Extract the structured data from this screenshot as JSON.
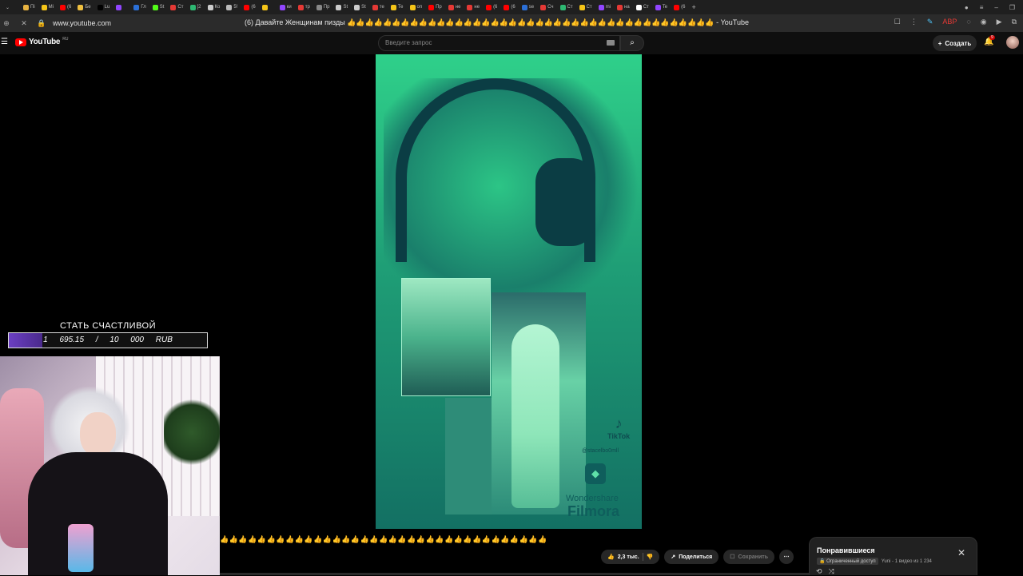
{
  "browser": {
    "tabs": [
      {
        "label": "Пі",
        "color": "#e8b341"
      },
      {
        "label": "Mi",
        "color": "#f5c518"
      },
      {
        "label": "(6",
        "color": "#ff0000"
      },
      {
        "label": "Бе",
        "color": "#f0c040"
      },
      {
        "label": "Lu",
        "color": "#000000"
      },
      {
        "label": "",
        "color": "#9146ff"
      },
      {
        "label": "Гл",
        "color": "#2b6fd6"
      },
      {
        "label": "St",
        "color": "#53fc18"
      },
      {
        "label": "Ст",
        "color": "#e53935"
      },
      {
        "label": "[2",
        "color": "#2eb872"
      },
      {
        "label": "Ко",
        "color": "#cccccc"
      },
      {
        "label": "5!",
        "color": "#bbbbbb"
      },
      {
        "label": "(6",
        "color": "#ff0000"
      },
      {
        "label": "",
        "color": "#f5c518"
      },
      {
        "label": "ки",
        "color": "#9146ff"
      },
      {
        "label": "тр",
        "color": "#e53935"
      },
      {
        "label": "Пр",
        "color": "#888888"
      },
      {
        "label": "St",
        "color": "#cccccc"
      },
      {
        "label": "St",
        "color": "#cccccc"
      },
      {
        "label": "те",
        "color": "#e53935"
      },
      {
        "label": "Те",
        "color": "#f5c518"
      },
      {
        "label": "оп",
        "color": "#f5c518"
      },
      {
        "label": "Пр",
        "color": "#ff0000"
      },
      {
        "label": "не",
        "color": "#e53935"
      },
      {
        "label": "не",
        "color": "#e53935"
      },
      {
        "label": "(6",
        "color": "#ff0000"
      },
      {
        "label": "(6",
        "color": "#ff0000"
      },
      {
        "label": "se",
        "color": "#2b6fd6"
      },
      {
        "label": "Сч",
        "color": "#e53935"
      },
      {
        "label": "Ст",
        "color": "#2eb872"
      },
      {
        "label": "Ст",
        "color": "#f5c518"
      },
      {
        "label": "mi",
        "color": "#9146ff"
      },
      {
        "label": "на",
        "color": "#e53935"
      },
      {
        "label": "Ст",
        "color": "#ffffff"
      },
      {
        "label": "Te",
        "color": "#9146ff"
      },
      {
        "label": "(6",
        "color": "#ff0000"
      }
    ],
    "url": "www.youtube.com",
    "page_title": "(6) Давайте Женщинам пизды 👍👍👍👍👍👍👍👍👍👍👍👍👍👍👍👍👍👍👍👍👍👍👍👍👍👍👍👍👍👍👍👍👍👍👍👍👍👍👍👍👍 - YouTube"
  },
  "youtube": {
    "logo_text": "YouTube",
    "logo_region": "RU",
    "search_placeholder": "Введите запрос",
    "create_label": "Создать",
    "notif_count": "9"
  },
  "overlay": {
    "goal_title": "СТАТЬ СЧАСТЛИВОЙ",
    "goal_text": "1 695.15 / 10 000 RUB",
    "goal_progress": 0.1695
  },
  "video": {
    "tiktok_label": "TikTok",
    "tiktok_handle": "@stacelbo0mll",
    "watermark_1": "Wondershare",
    "watermark_2": "Filmora"
  },
  "below": {
    "title_tail": "👍👍👍👍👍👍👍👍👍👍👍👍👍👍👍👍👍👍👍👍👍👍👍👍👍👍👍👍👍👍👍👍👍👍👍",
    "like_count": "2,3 тыс.",
    "share_label": "Поделиться",
    "save_label": "Сохранить"
  },
  "playlist": {
    "title": "Понравившиеся",
    "access": "Ограниченный доступ",
    "meta": "Yuni - 1 видео из 1 234"
  }
}
